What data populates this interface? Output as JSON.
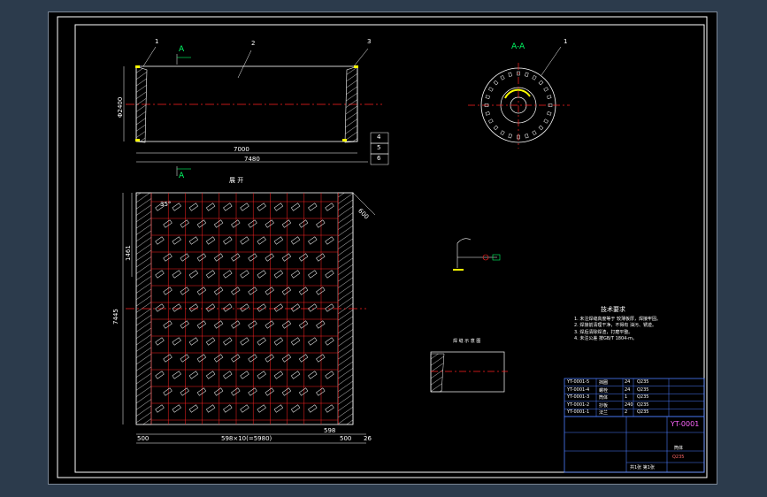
{
  "top_view": {
    "part_1": "1",
    "part_2": "2",
    "part_3": "3",
    "section_a": "A",
    "dim_inner": "7000",
    "dim_overall": "7480",
    "dim_dia": "Φ2400",
    "callout_4": "4",
    "callout_5": "5",
    "callout_6": "6"
  },
  "section_view": {
    "title": "A-A",
    "part_1": "1"
  },
  "flat_view": {
    "title": "展 开",
    "dim_height": "7445",
    "dim_left_pitch": "1461",
    "dim_angle": "35°",
    "dim_right": "600",
    "dim_bottom_left": "500",
    "dim_bottom_mid": "598",
    "dim_bottom_total": "598×10(=5980)",
    "dim_bottom_right": "500",
    "dim_bottom_edge": "26"
  },
  "weld_detail_title": "焊 缝 示 意 图",
  "notes": {
    "title": "技术要求",
    "lines": [
      "1. 未注焊缝高度等于 较薄板厚，焊接牢固。",
      "2. 焊接前清理干净，不得有 油污、锈迹。",
      "3. 焊后清除焊渣，打磨平整。",
      "4. 未注公差 按GB/T 1804-m。"
    ]
  },
  "bom": [
    {
      "code": "YT-0001-5",
      "name": "挡圈",
      "qty": "24",
      "mat": "Q235"
    },
    {
      "code": "YT-0001-4",
      "name": "螺栓",
      "qty": "24",
      "mat": "Q235"
    },
    {
      "code": "YT-0001-3",
      "name": "筒体",
      "qty": "1",
      "mat": "Q235"
    },
    {
      "code": "YT-0001-2",
      "name": "抄板",
      "qty": "240",
      "mat": "Q235"
    },
    {
      "code": "YT-0001-1",
      "name": "法兰",
      "qty": "2",
      "mat": "Q235"
    }
  ],
  "title_block": {
    "name": "筒体",
    "drawing_no": "YT-0001",
    "material": "Q235",
    "sheet": "共1张 第1张"
  },
  "colors": {
    "background": "#000000",
    "frame": "#ffffff",
    "centerline": "#ff0000",
    "weld": "#ffff00",
    "section_label": "#00ff66",
    "leader": "#00ffff"
  }
}
